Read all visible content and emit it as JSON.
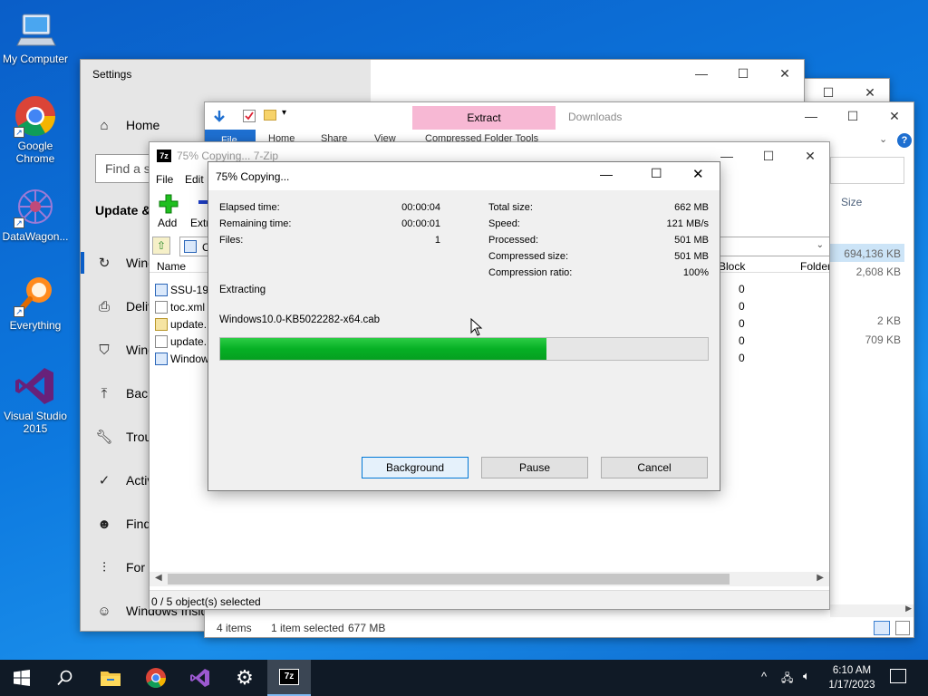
{
  "desktop": {
    "icons": [
      {
        "label": "My Computer"
      },
      {
        "label": "Google Chrome"
      },
      {
        "label": "DataWagon..."
      },
      {
        "label": "Everything"
      },
      {
        "label": "Visual Studio 2015"
      }
    ]
  },
  "settings": {
    "title": "Settings",
    "home": "Home",
    "search_placeholder": "Find a s",
    "section": "Update &",
    "items": [
      "Wind",
      "Deliv",
      "Wind",
      "Back",
      "Trou",
      "Activ",
      "Find",
      "For d",
      "Windows Insid"
    ]
  },
  "explorer": {
    "contextual_tab": "Extract",
    "downloads_label": "Downloads",
    "tabs": [
      "File",
      "Home",
      "Share",
      "View"
    ],
    "context_group": "Compressed Folder Tools",
    "column_size": "Size",
    "sizes": [
      "694,136 KB",
      "2,608 KB",
      "2 KB",
      "709 KB"
    ],
    "status_items": "4 items",
    "status_selected": "1 item selected",
    "status_size": "677 MB"
  },
  "zip": {
    "title": "75% Copying... 7-Zip",
    "menu": [
      "File",
      "Edit"
    ],
    "toolbar_add": "Add",
    "toolbar_extract": "Extr",
    "path_prefix": "C",
    "col_name": "Name",
    "col_block": "Block",
    "col_folder": "Folder",
    "files": [
      "SSU-190",
      "toc.xml",
      "update.",
      "update.",
      "Window"
    ],
    "blocks": [
      "0",
      "0",
      "0",
      "0",
      "0"
    ],
    "status": "0 / 5 object(s) selected"
  },
  "dialog": {
    "title": "75% Copying...",
    "elapsed_label": "Elapsed time:",
    "elapsed_value": "00:00:04",
    "remaining_label": "Remaining time:",
    "remaining_value": "00:00:01",
    "files_label": "Files:",
    "files_value": "1",
    "total_label": "Total size:",
    "total_value": "662 MB",
    "speed_label": "Speed:",
    "speed_value": "121 MB/s",
    "processed_label": "Processed:",
    "processed_value": "501 MB",
    "compressed_label": "Compressed size:",
    "compressed_value": "501 MB",
    "ratio_label": "Compression ratio:",
    "ratio_value": "100%",
    "action": "Extracting",
    "current_file": "Windows10.0-KB5022282-x64.cab",
    "progress_fraction": 0.67,
    "btn_background": "Background",
    "btn_pause": "Pause",
    "btn_cancel": "Cancel"
  },
  "taskbar": {
    "time": "6:10 AM",
    "date": "1/17/2023",
    "zip_icon_text": "7z"
  },
  "colors": {
    "accent": "#0a5ec8",
    "progress": "#06b025",
    "taskbar": "#101a26"
  }
}
